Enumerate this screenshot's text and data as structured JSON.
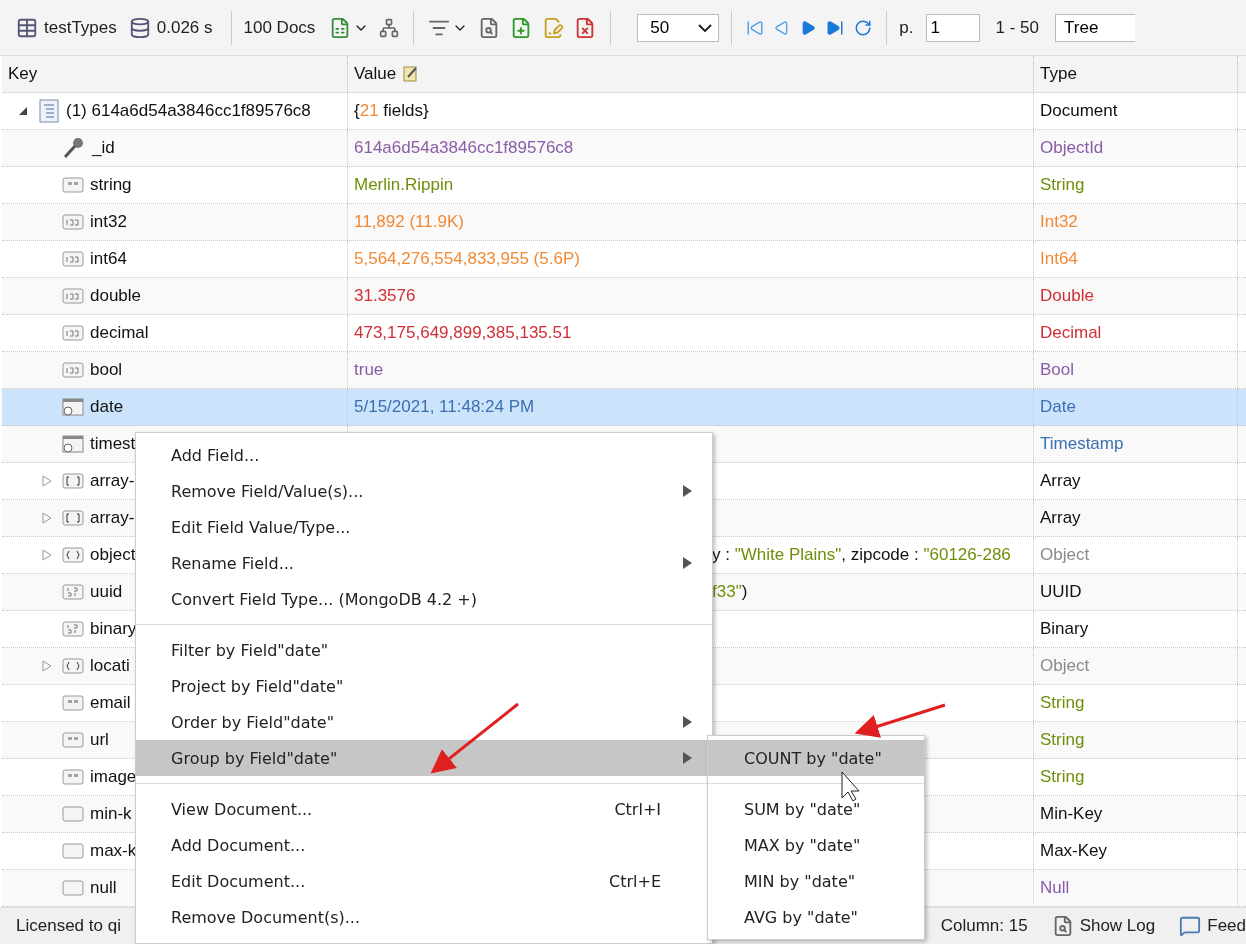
{
  "toolbar": {
    "collection": "testTypes",
    "time": "0.026 s",
    "docs": "100 Docs",
    "page_size": "50",
    "page_label": "p.",
    "page": "1",
    "range": "1 - 50",
    "view": "Tree"
  },
  "table": {
    "columns": [
      "Key",
      "Value",
      "Type"
    ],
    "rows": [
      {
        "kind": "document",
        "key": "(1) 614a6d54a3846cc1f89576c8",
        "expanded": true,
        "selected": false,
        "value": [
          {
            "kind": "punct",
            "text": "{"
          },
          {
            "kind": "number",
            "text": "21"
          },
          {
            "kind": "punct",
            "text": " fields}"
          }
        ],
        "type": "Document"
      },
      {
        "kind": "objectid",
        "key": "_id",
        "selected": false,
        "value": [
          {
            "kind": "value",
            "text": "614a6d54a3846cc1f89576c8"
          }
        ],
        "type": "ObjectId"
      },
      {
        "kind": "string",
        "key": "string",
        "selected": false,
        "value": [
          {
            "kind": "value",
            "text": "Merlin.Rippin"
          }
        ],
        "type": "String"
      },
      {
        "kind": "int32",
        "key": "int32",
        "selected": false,
        "value": [
          {
            "kind": "value",
            "text": "11,892 (11.9K)"
          }
        ],
        "type": "Int32"
      },
      {
        "kind": "int64",
        "key": "int64",
        "selected": false,
        "value": [
          {
            "kind": "value",
            "text": "5,564,276,554,833,955 (5.6P)"
          }
        ],
        "type": "Int64"
      },
      {
        "kind": "double",
        "key": "double",
        "selected": false,
        "value": [
          {
            "kind": "value",
            "text": "31.3576"
          }
        ],
        "type": "Double"
      },
      {
        "kind": "decimal",
        "key": "decimal",
        "selected": false,
        "value": [
          {
            "kind": "value",
            "text": "473,175,649,899,385,135.51"
          }
        ],
        "type": "Decimal"
      },
      {
        "kind": "bool",
        "key": "bool",
        "selected": false,
        "value": [
          {
            "kind": "value",
            "text": "true"
          }
        ],
        "type": "Bool"
      },
      {
        "kind": "date",
        "key": "date",
        "selected": true,
        "value": [
          {
            "kind": "value",
            "text": "5/15/2021, 11:48:24 PM"
          }
        ],
        "type": "Date"
      },
      {
        "kind": "timestamp",
        "key": "timest",
        "selected": false,
        "value": [],
        "type": "Timestamp"
      },
      {
        "kind": "array",
        "key": "array-",
        "expanded": false,
        "selected": false,
        "value": [],
        "type": "Array"
      },
      {
        "kind": "array",
        "key": "array-",
        "expanded": false,
        "selected": false,
        "value": [],
        "type": "Array"
      },
      {
        "kind": "object",
        "key": "object",
        "expanded": false,
        "selected": false,
        "value": [
          {
            "kind": "punct",
            "text": "y : "
          },
          {
            "kind": "string",
            "text": "\"White Plains\""
          },
          {
            "kind": "punct",
            "text": ", zipcode : "
          },
          {
            "kind": "string",
            "text": "\"60126-286"
          }
        ],
        "type": "Object"
      },
      {
        "kind": "uuid",
        "key": "uuid",
        "selected": false,
        "value": [
          {
            "kind": "string",
            "text": "f33\""
          },
          {
            "kind": "punct",
            "text": ")"
          }
        ],
        "type": "UUID"
      },
      {
        "kind": "binary",
        "key": "binary",
        "selected": false,
        "value": [],
        "type": "Binary"
      },
      {
        "kind": "object",
        "key": "locati",
        "expanded": false,
        "selected": false,
        "value": [],
        "type": "Object"
      },
      {
        "kind": "string",
        "key": "email",
        "selected": false,
        "value": [],
        "type": "String"
      },
      {
        "kind": "string",
        "key": "url",
        "selected": false,
        "value": [],
        "type": "String"
      },
      {
        "kind": "string",
        "key": "image",
        "selected": false,
        "value": [],
        "type": "String"
      },
      {
        "kind": "minkey",
        "key": "min-k",
        "selected": false,
        "value": [],
        "type": "Min-Key"
      },
      {
        "kind": "maxkey",
        "key": "max-k",
        "selected": false,
        "value": [],
        "type": "Max-Key"
      },
      {
        "kind": "null",
        "key": "null",
        "selected": false,
        "value": [],
        "type": "Null"
      }
    ]
  },
  "context_menu": {
    "items": [
      {
        "kind": "item",
        "label": "Add Field...",
        "submenu": false,
        "selected": false
      },
      {
        "kind": "item",
        "label": "Remove Field/Value(s)...",
        "submenu": true,
        "selected": false
      },
      {
        "kind": "item",
        "label": "Edit Field Value/Type...",
        "submenu": false,
        "selected": false
      },
      {
        "kind": "item",
        "label": "Rename Field...",
        "submenu": true,
        "selected": false
      },
      {
        "kind": "item",
        "label": "Convert Field Type... (MongoDB 4.2 +)",
        "submenu": false,
        "selected": false
      },
      {
        "kind": "separator"
      },
      {
        "kind": "item",
        "label": "Filter by Field\"date\"",
        "submenu": false,
        "selected": false
      },
      {
        "kind": "item",
        "label": "Project by Field\"date\"",
        "submenu": false,
        "selected": false
      },
      {
        "kind": "item",
        "label": "Order by Field\"date\"",
        "submenu": true,
        "selected": false
      },
      {
        "kind": "item",
        "label": "Group by Field\"date\"",
        "submenu": true,
        "selected": true
      },
      {
        "kind": "separator"
      },
      {
        "kind": "item",
        "label": "View Document...",
        "shortcut": "Ctrl+I",
        "submenu": false,
        "selected": false
      },
      {
        "kind": "item",
        "label": "Add Document...",
        "submenu": false,
        "selected": false
      },
      {
        "kind": "item",
        "label": "Edit Document...",
        "shortcut": "Ctrl+E",
        "submenu": false,
        "selected": false
      },
      {
        "kind": "item",
        "label": "Remove Document(s)...",
        "submenu": false,
        "selected": false
      }
    ]
  },
  "submenu": {
    "items": [
      {
        "kind": "item",
        "label": "COUNT by \"date\"",
        "selected": true
      },
      {
        "kind": "separator"
      },
      {
        "kind": "item",
        "label": "SUM by \"date\"",
        "selected": false
      },
      {
        "kind": "item",
        "label": "MAX by \"date\"",
        "selected": false
      },
      {
        "kind": "item",
        "label": "MIN by \"date\"",
        "selected": false
      },
      {
        "kind": "item",
        "label": "AVG by \"date\"",
        "selected": false
      }
    ]
  },
  "status_bar": {
    "license": "Licensed to qi",
    "column": "Column: 15",
    "show_log": "Show Log",
    "feedback": "Feed"
  }
}
